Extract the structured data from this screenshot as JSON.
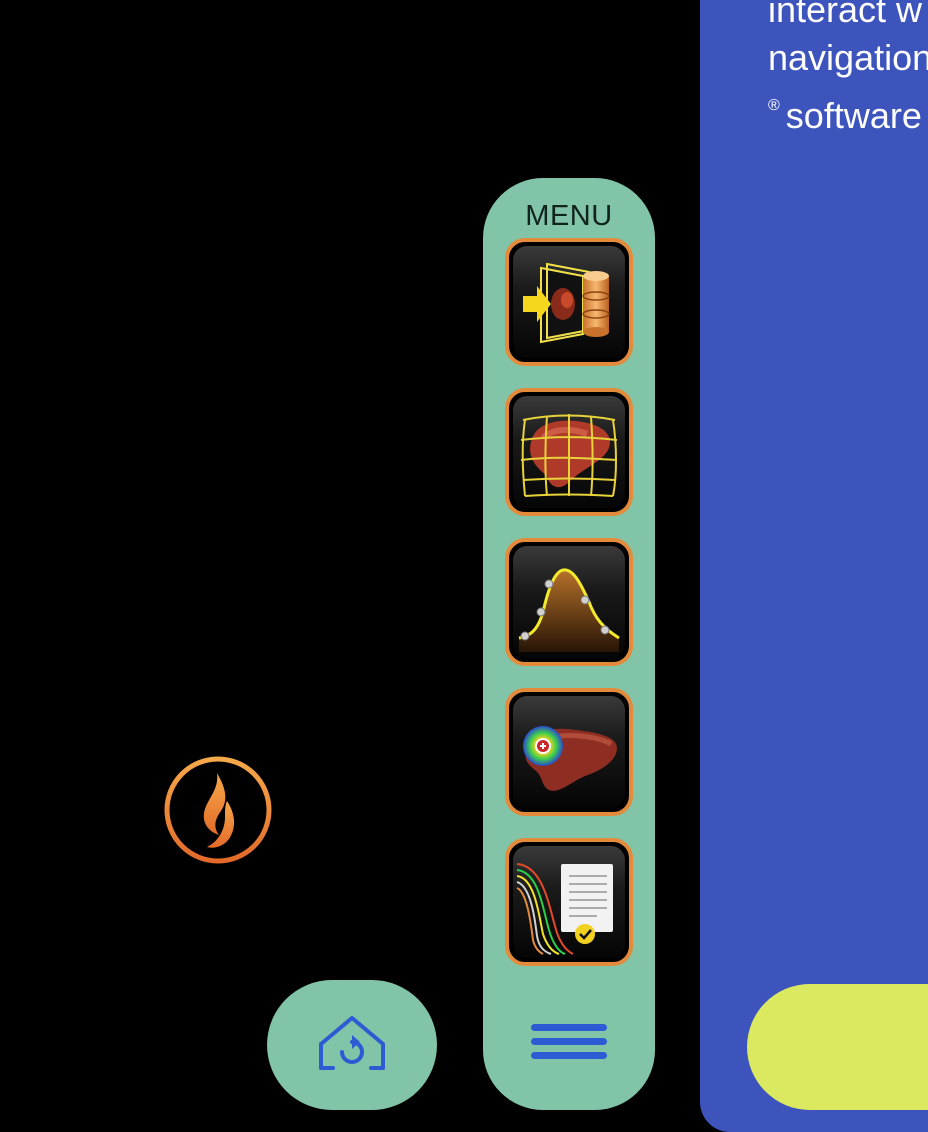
{
  "info_panel": {
    "line1": "interact w",
    "line2": "navigation",
    "reg_mark": "®",
    "line3": "software"
  },
  "menu": {
    "label": "MENU",
    "items": [
      {
        "icon": "import-data-icon"
      },
      {
        "icon": "liver-registration-grid-icon"
      },
      {
        "icon": "curve-analysis-icon"
      },
      {
        "icon": "liver-ablation-zone-icon"
      },
      {
        "icon": "report-document-icon"
      }
    ]
  },
  "colors": {
    "background": "#000000",
    "panel_blue": "#3e54bd",
    "menu_green": "#82c4a8",
    "accent_orange": "#e38b3b",
    "button_yellow": "#dbe961",
    "icon_blue": "#2d5bd3"
  }
}
